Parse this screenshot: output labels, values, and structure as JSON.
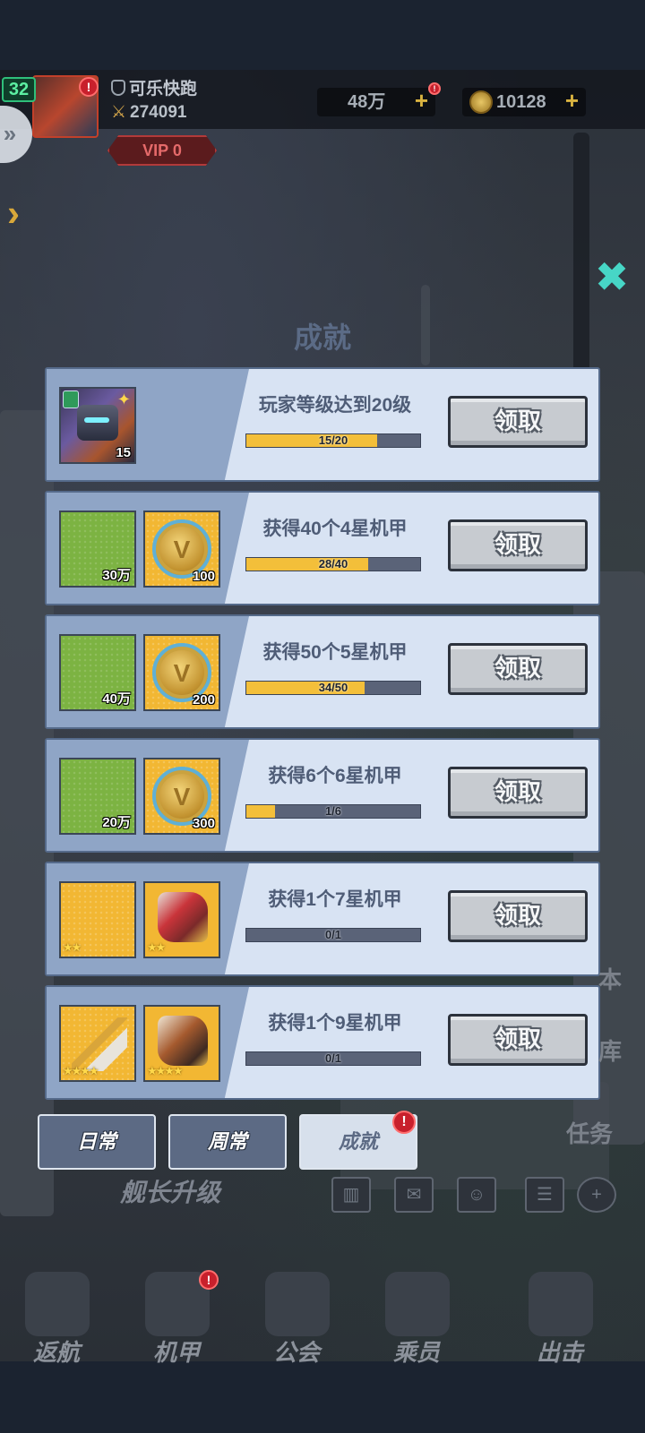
{
  "header": {
    "level": "32",
    "player_name": "可乐快跑",
    "power": "274091",
    "vip": "VIP 0",
    "currency_1": "48万",
    "currency_2": "10128"
  },
  "section_title": "成就",
  "achievements": [
    {
      "title": "玩家等级达到20级",
      "progress_text": "15/20",
      "progress": 0.75,
      "button": "领取",
      "rewards": [
        {
          "type": "portrait",
          "qty": "15"
        }
      ]
    },
    {
      "title": "获得40个4星机甲",
      "progress_text": "28/40",
      "progress": 0.7,
      "button": "领取",
      "rewards": [
        {
          "type": "green-tile",
          "qty": "30万"
        },
        {
          "type": "medal",
          "qty": "100"
        }
      ]
    },
    {
      "title": "获得50个5星机甲",
      "progress_text": "34/50",
      "progress": 0.68,
      "button": "领取",
      "rewards": [
        {
          "type": "green-tile",
          "qty": "40万"
        },
        {
          "type": "medal",
          "qty": "200"
        }
      ]
    },
    {
      "title": "获得6个6星机甲",
      "progress_text": "1/6",
      "progress": 0.1667,
      "button": "领取",
      "rewards": [
        {
          "type": "green-tile",
          "qty": "20万"
        },
        {
          "type": "medal",
          "qty": "300"
        }
      ]
    },
    {
      "title": "获得1个7星机甲",
      "progress_text": "0/1",
      "progress": 0,
      "button": "领取",
      "rewards": [
        {
          "type": "gold-tile",
          "stars": "★★"
        },
        {
          "type": "mech-red",
          "stars": "★★"
        }
      ]
    },
    {
      "title": "获得1个9星机甲",
      "progress_text": "0/1",
      "progress": 0,
      "button": "领取",
      "rewards": [
        {
          "type": "sword",
          "stars": "★★★★"
        },
        {
          "type": "mech-brown",
          "stars": "★★★★"
        }
      ]
    }
  ],
  "tabs": [
    {
      "label": "日常",
      "active": false
    },
    {
      "label": "周常",
      "active": false
    },
    {
      "label": "成就",
      "active": true,
      "badge": "!"
    }
  ],
  "background": {
    "hud_label": "舰长升级",
    "side_labels": [
      "本",
      "库",
      "任务"
    ],
    "nav": [
      "返航",
      "机甲",
      "公会",
      "乘员",
      "出击"
    ]
  },
  "colors": {
    "progress_fill": "#f3bf3a",
    "progress_track": "#5a6378",
    "card_bg": "#d8e3f3",
    "tab_active": "#d7e0ec",
    "tab_inactive": "#5c6a84"
  }
}
